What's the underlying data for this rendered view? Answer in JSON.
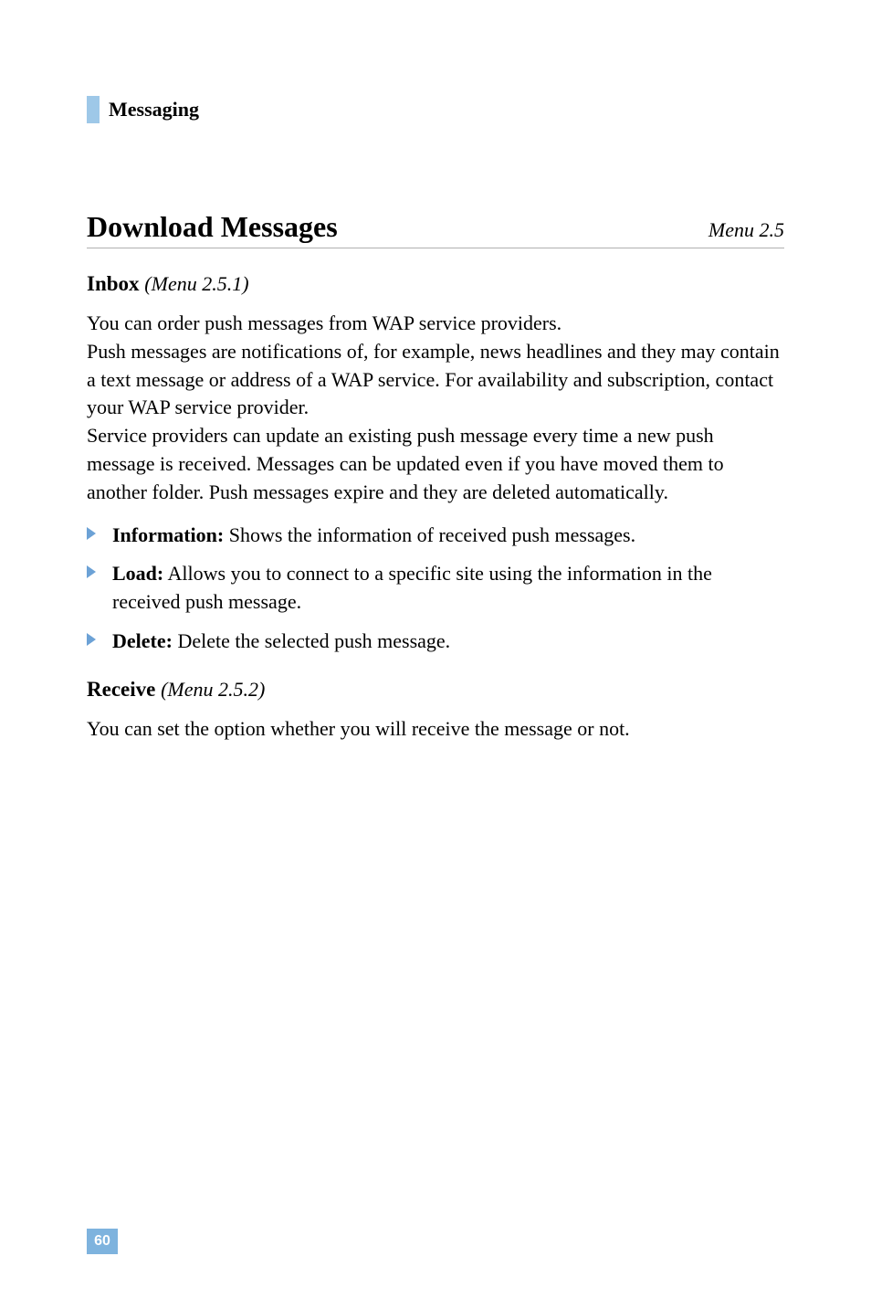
{
  "section": {
    "title": "Messaging"
  },
  "heading": {
    "title": "Download Messages",
    "menu": "Menu 2.5"
  },
  "inbox": {
    "title": "Inbox",
    "menu": "(Menu 2.5.1)",
    "paragraph": "You can order push messages from WAP service providers.\nPush messages are notifications of, for example, news headlines and they may contain a text message or address of a WAP service. For availability and subscription, contact your WAP service provider.\nService providers can update an existing push message every time a new push message is received. Messages can be updated even if you have moved them to another folder. Push messages expire and they are deleted automatically.",
    "bullets": [
      {
        "label": "Information:",
        "text": " Shows the information of received push messages."
      },
      {
        "label": "Load:",
        "text": " Allows you to connect to a specific site using the information in the received push message."
      },
      {
        "label": "Delete:",
        "text": " Delete the selected push message."
      }
    ]
  },
  "receive": {
    "title": "Receive",
    "menu": "(Menu 2.5.2)",
    "paragraph": "You can set the option whether you will receive the message or not."
  },
  "page_number": "60"
}
